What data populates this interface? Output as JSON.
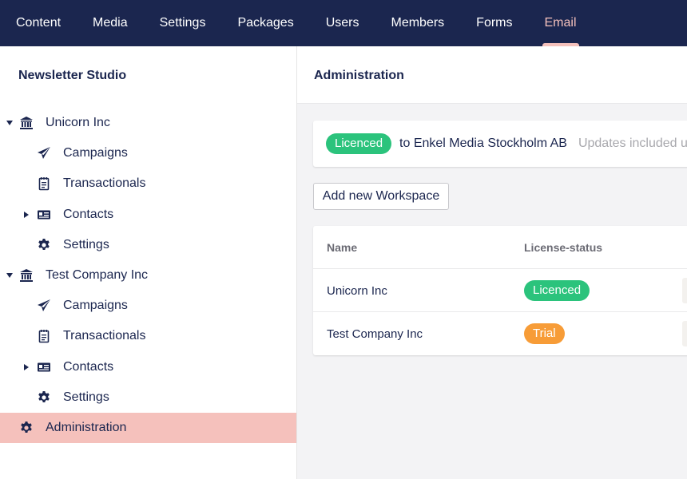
{
  "nav": {
    "items": [
      "Content",
      "Media",
      "Settings",
      "Packages",
      "Users",
      "Members",
      "Forms",
      "Email"
    ],
    "active": "Email"
  },
  "sidebar": {
    "title": "Newsletter Studio",
    "workspaces": [
      {
        "name": "Unicorn Inc",
        "icon": "bank-icon",
        "children": [
          {
            "label": "Campaigns",
            "icon": "paper-plane-icon",
            "expandable": false
          },
          {
            "label": "Transactionals",
            "icon": "notepad-icon",
            "expandable": false
          },
          {
            "label": "Contacts",
            "icon": "id-card-icon",
            "expandable": true
          },
          {
            "label": "Settings",
            "icon": "gear-icon",
            "expandable": false
          }
        ]
      },
      {
        "name": "Test Company Inc",
        "icon": "bank-icon",
        "children": [
          {
            "label": "Campaigns",
            "icon": "paper-plane-icon",
            "expandable": false
          },
          {
            "label": "Transactionals",
            "icon": "notepad-icon",
            "expandable": false
          },
          {
            "label": "Contacts",
            "icon": "id-card-icon",
            "expandable": true
          },
          {
            "label": "Settings",
            "icon": "gear-icon",
            "expandable": false
          }
        ]
      }
    ],
    "administration": {
      "label": "Administration",
      "icon": "gear-icon"
    }
  },
  "main": {
    "title": "Administration",
    "license": {
      "badge": "Licenced",
      "to": "to Enkel Media Stockholm AB",
      "updates": "Updates included until"
    },
    "add_button": "Add new Workspace",
    "table": {
      "headers": {
        "name": "Name",
        "status": "License-status"
      },
      "rows": [
        {
          "name": "Unicorn Inc",
          "status": "Licenced",
          "status_color": "#2bc37c"
        },
        {
          "name": "Test Company Inc",
          "status": "Trial",
          "status_color": "#f79c37"
        }
      ]
    }
  },
  "colors": {
    "nav_bg": "#1b264f",
    "accent": "#f5c1bc",
    "licenced": "#2bc37c",
    "trial": "#f79c37"
  }
}
